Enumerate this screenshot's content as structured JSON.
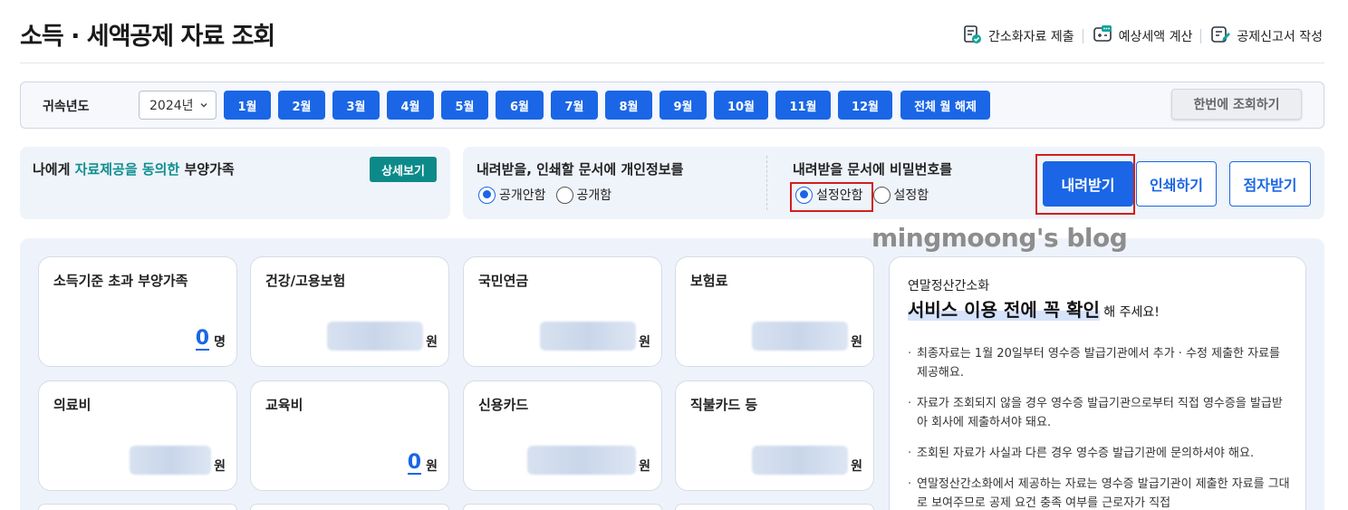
{
  "header": {
    "title": "소득 · 세액공제 자료 조회",
    "actions": [
      {
        "label": "간소화자료 제출",
        "icon": "document-check-icon"
      },
      {
        "label": "예상세액 계산",
        "icon": "calculator-icon"
      },
      {
        "label": "공제신고서 작성",
        "icon": "document-edit-icon"
      }
    ]
  },
  "filter": {
    "label": "귀속년도",
    "year": "2024년",
    "months": [
      "1월",
      "2월",
      "3월",
      "4월",
      "5월",
      "6월",
      "7월",
      "8월",
      "9월",
      "10월",
      "11월",
      "12월"
    ],
    "clear_all": "전체 월 해제",
    "query_all": "한번에 조회하기"
  },
  "dependents": {
    "prefix": "나에게 ",
    "highlight": "자료제공을 동의한",
    "suffix": " 부양가족",
    "detail_button": "상세보기"
  },
  "options": {
    "privacy": {
      "title": "내려받을, 인쇄할 문서에 개인정보를",
      "choices": [
        "공개안함",
        "공개함"
      ],
      "selected": 0
    },
    "password": {
      "title": "내려받을 문서에 비밀번호를",
      "choices": [
        "설정안함",
        "설정함"
      ],
      "selected": 0
    },
    "buttons": {
      "download": "내려받기",
      "print": "인쇄하기",
      "braille": "점자받기"
    }
  },
  "watermark": "mingmoong's blog",
  "cards": [
    {
      "title": "소득기준 초과 부양가족",
      "value": "0",
      "unit": "명",
      "hidden": false
    },
    {
      "title": "건강/고용보험",
      "value": "",
      "unit": "원",
      "hidden": true
    },
    {
      "title": "국민연금",
      "value": "",
      "unit": "원",
      "hidden": true
    },
    {
      "title": "보험료",
      "value": "",
      "unit": "원",
      "hidden": true
    },
    {
      "title": "의료비",
      "value": "",
      "unit": "원",
      "hidden": true
    },
    {
      "title": "교육비",
      "value": "0",
      "unit": "원",
      "hidden": false
    },
    {
      "title": "신용카드",
      "value": "",
      "unit": "원",
      "hidden": true
    },
    {
      "title": "직불카드 등",
      "value": "",
      "unit": "원",
      "hidden": true
    }
  ],
  "notice": {
    "subtitle": "연말정산간소화",
    "heading": "서비스 이용 전에 꼭 확인",
    "heading_tail": " 해 주세요!",
    "items": [
      "최종자료는 1월 20일부터 영수증 발급기관에서 추가 · 수정 제출한 자료를 제공해요.",
      "자료가 조회되지 않을 경우 영수증 발급기관으로부터 직접 영수증을 발급받아 회사에 제출하셔야 돼요.",
      "조회된 자료가 사실과 다른 경우 영수증 발급기관에 문의하셔야 해요.",
      "연말정산간소화에서 제공하는 자료는 영수증 발급기관이 제출한 자료를 그대로 보여주므로 공제 요건 충족 여부를 근로자가 직접"
    ]
  },
  "colors": {
    "primary": "#1a66e6",
    "teal": "#0c8a8a",
    "highlight_box": "#d0201c",
    "panel": "#eff3fa"
  }
}
